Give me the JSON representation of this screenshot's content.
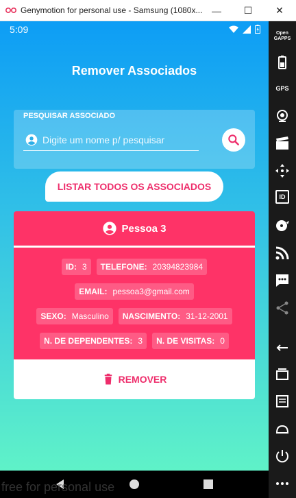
{
  "window": {
    "title": "Genymotion for personal use - Samsung (1080x...",
    "minimize": "—",
    "maximize": "☐",
    "close": "✕"
  },
  "statusbar": {
    "time": "5:09"
  },
  "page": {
    "title": "Remover Associados"
  },
  "search": {
    "label": "PESQUISAR ASSOCIADO",
    "placeholder": "Digite um nome p/ pesquisar",
    "value": ""
  },
  "list_all_button": "LISTAR TODOS OS ASSOCIADOS",
  "associate": {
    "name": "Pessoa 3",
    "fields": {
      "id_label": "ID:",
      "id": "3",
      "phone_label": "TELEFONE:",
      "phone": "20394823984",
      "email_label": "EMAIL:",
      "email": "pessoa3@gmail.com",
      "sex_label": "SEXO:",
      "sex": "Masculino",
      "birth_label": "NASCIMENTO:",
      "birth": "31-12-2001",
      "dependents_label": "N. DE DEPENDENTES:",
      "dependents": "3",
      "visits_label": "N. DE VISITAS:",
      "visits": "0"
    },
    "remove_button": "REMOVER"
  },
  "toolbar": {
    "opengapps": "Open GAPPS",
    "gps": "GPS",
    "id": "ID"
  },
  "watermark": "free for personal use",
  "colors": {
    "accent": "#fe3367",
    "accent_text": "#ee2d6b",
    "gradient_top": "#0d9df5",
    "gradient_bottom": "#5ff2c8"
  }
}
